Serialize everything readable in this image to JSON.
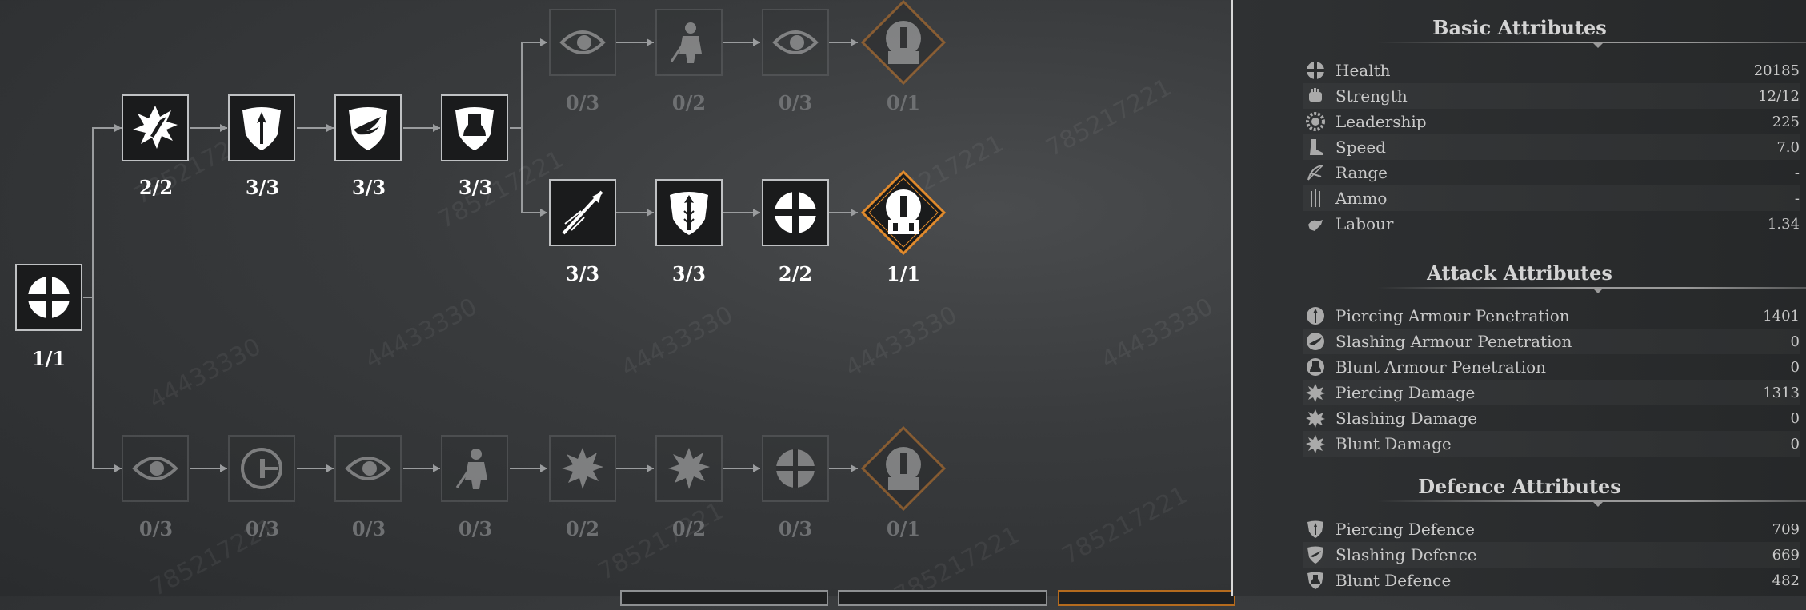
{
  "tree": {
    "root": {
      "icon": "cross-shield-icon",
      "level": "1/1"
    },
    "top_branch": [
      {
        "icon": "sword-burst-icon",
        "level": "2/2",
        "locked": false
      },
      {
        "icon": "arrow-shield-icon",
        "level": "3/3",
        "locked": false
      },
      {
        "icon": "wing-shield-icon",
        "level": "3/3",
        "locked": false
      },
      {
        "icon": "bell-shield-icon",
        "level": "3/3",
        "locked": false
      }
    ],
    "top_locked_row": [
      {
        "icon": "eye-slash-icon",
        "level": "0/3"
      },
      {
        "icon": "warrior-icon",
        "level": "0/2"
      },
      {
        "icon": "eye-slash-icon",
        "level": "0/3"
      },
      {
        "icon": "helmet-diamond-icon",
        "level": "0/1"
      }
    ],
    "middle_row": [
      {
        "icon": "spear-throw-icon",
        "level": "3/3"
      },
      {
        "icon": "arrow-shield-icon",
        "level": "3/3"
      },
      {
        "icon": "cross-shield-icon",
        "level": "2/2"
      },
      {
        "icon": "helmet-diamond-icon",
        "level": "1/1"
      }
    ],
    "bottom_row": [
      {
        "icon": "eye-slash-icon",
        "level": "0/3"
      },
      {
        "icon": "circle-minus-icon",
        "level": "0/3"
      },
      {
        "icon": "eye-slash-icon",
        "level": "0/3"
      },
      {
        "icon": "warrior-icon",
        "level": "0/3"
      },
      {
        "icon": "burst-icon",
        "level": "0/2"
      },
      {
        "icon": "burst-icon",
        "level": "0/2"
      },
      {
        "icon": "cross-shield-icon",
        "level": "0/3"
      },
      {
        "icon": "helmet-diamond-icon",
        "level": "0/1"
      }
    ],
    "watermark": "785217221",
    "watermark_alt": "44433330"
  },
  "panel": {
    "basic": {
      "title": "Basic Attributes",
      "rows": [
        {
          "icon": "health-cross-icon",
          "label": "Health",
          "value": "20185"
        },
        {
          "icon": "strength-fist-icon",
          "label": "Strength",
          "value": "12/12"
        },
        {
          "icon": "leadership-gear-icon",
          "label": "Leadership",
          "value": "225"
        },
        {
          "icon": "speed-boot-icon",
          "label": "Speed",
          "value": "7.0"
        },
        {
          "icon": "range-bow-icon",
          "label": "Range",
          "value": "-"
        },
        {
          "icon": "ammo-arrows-icon",
          "label": "Ammo",
          "value": "-"
        },
        {
          "icon": "labour-hand-icon",
          "label": "Labour",
          "value": "1.34"
        }
      ]
    },
    "attack": {
      "title": "Attack Attributes",
      "rows": [
        {
          "icon": "piercing-pen-icon",
          "label": "Piercing Armour Penetration",
          "value": "1401"
        },
        {
          "icon": "slashing-pen-icon",
          "label": "Slashing Armour Penetration",
          "value": "0"
        },
        {
          "icon": "blunt-pen-icon",
          "label": "Blunt Armour Penetration",
          "value": "0"
        },
        {
          "icon": "piercing-dmg-icon",
          "label": "Piercing Damage",
          "value": "1313"
        },
        {
          "icon": "slashing-dmg-icon",
          "label": "Slashing Damage",
          "value": "0"
        },
        {
          "icon": "blunt-dmg-icon",
          "label": "Blunt Damage",
          "value": "0"
        }
      ]
    },
    "defence": {
      "title": "Defence Attributes",
      "rows": [
        {
          "icon": "piercing-def-icon",
          "label": "Piercing Defence",
          "value": "709"
        },
        {
          "icon": "slashing-def-icon",
          "label": "Slashing Defence",
          "value": "669"
        },
        {
          "icon": "blunt-def-icon",
          "label": "Blunt Defence",
          "value": "482"
        }
      ]
    }
  }
}
